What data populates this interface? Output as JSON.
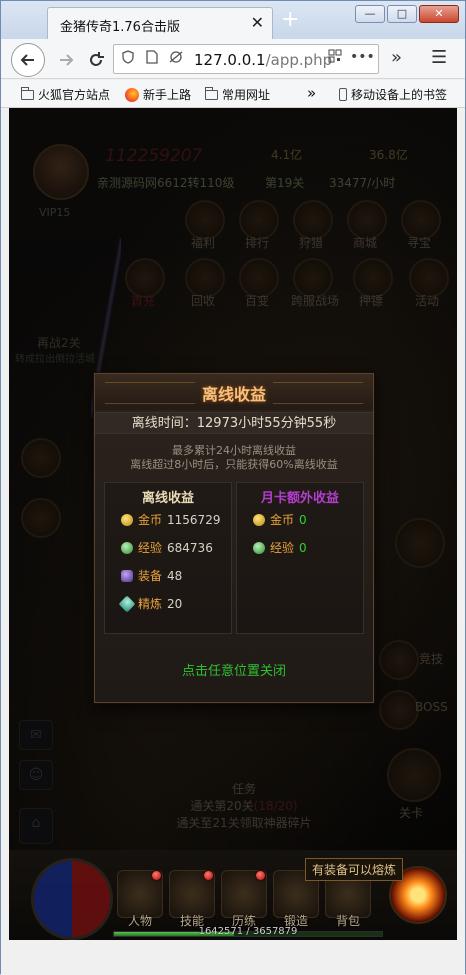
{
  "browser": {
    "tab_title": "金猪传奇1.76合击版",
    "tab_close": "✕",
    "new_tab": "+",
    "window_min": "—",
    "window_max": "□",
    "window_close": "✕",
    "url_host": "127.0.0.1",
    "url_path": "/app.php",
    "url_dots": "•••",
    "nav_overflow": "»",
    "menu": "☰",
    "bookmarks": [
      "火狐官方站点",
      "新手上路",
      "常用网址"
    ],
    "bookmarks_overflow": "»",
    "mobile_bookmarks": "移动设备上的书签"
  },
  "game": {
    "player_id": "112259207",
    "gold_top": "4.1亿",
    "gold_top2": "36.8亿",
    "vip": "VIP15",
    "server_line": "亲测源码网6612转110级",
    "stage_line": "第19关",
    "rate_line": "33477/小时",
    "ring_buttons": [
      "福利",
      "排行",
      "狩猎",
      "商城",
      "寻宝"
    ],
    "ring_buttons2": [
      "首充",
      "回收",
      "百变",
      "跨服战场",
      "押镖",
      "活动"
    ],
    "left_quest": "再战2关",
    "left_quest_sub": "转成拉出倒拉活城",
    "right_labels": [
      "竞技",
      "BOSS",
      "关卡"
    ],
    "quest_title": "任务",
    "quest_line1": "通关第20关",
    "quest_progress": "(18/20)",
    "quest_line2": "通关至21关领取神器碎片",
    "refine_tip": "有装备可以熔炼",
    "bottom_buttons": [
      "人物",
      "技能",
      "历练",
      "锻造",
      "背包"
    ],
    "exp_current": "1642571",
    "exp_max": "3657879",
    "exp_fraction": 0.449
  },
  "popup": {
    "title": "离线收益",
    "offline_time": "离线时间：12973小时55分钟55秒",
    "note1": "最多累计24小时离线收益",
    "note2": "离线超过8小时后，只能获得60%离线收益",
    "left_title": "离线收益",
    "right_title": "月卡额外收益",
    "left": {
      "gold_label": "金币",
      "gold_value": "1156729",
      "exp_label": "经验",
      "exp_value": "684736",
      "equip_label": "装备",
      "equip_value": "48",
      "refine_label": "精炼",
      "refine_value": "20"
    },
    "right": {
      "gold_label": "金币",
      "gold_value": "0",
      "exp_label": "经验",
      "exp_value": "0"
    },
    "close_hint": "点击任意位置关闭"
  }
}
